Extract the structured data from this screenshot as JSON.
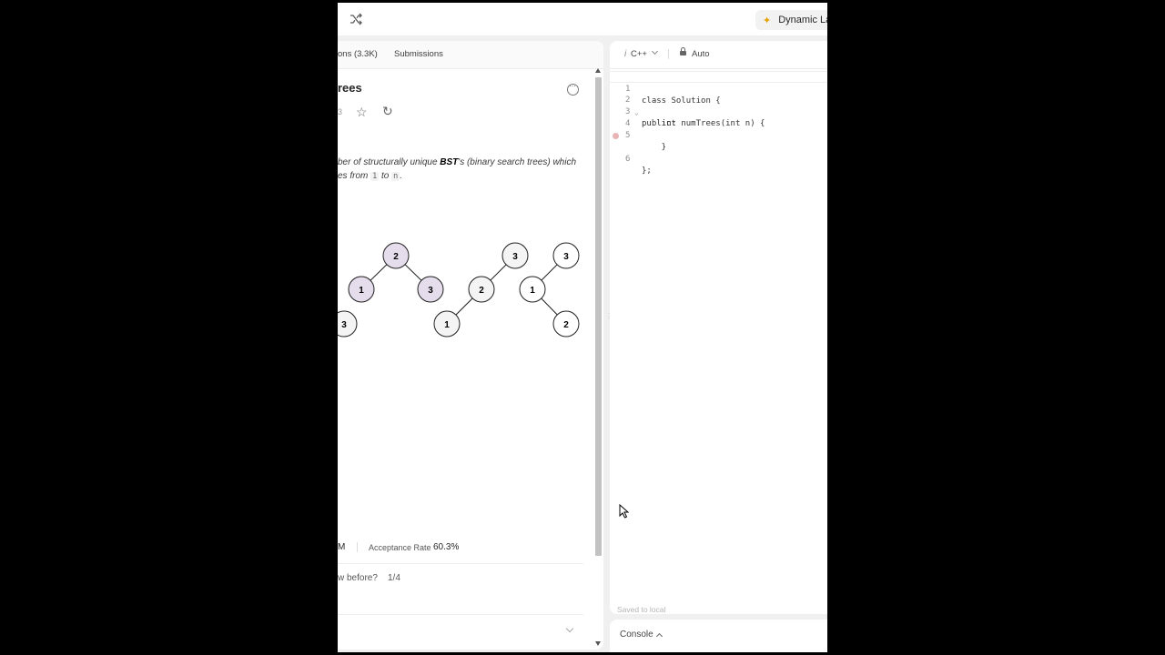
{
  "header": {
    "ai_button_label": "Dynamic Lay"
  },
  "left_panel": {
    "tabs": [
      "ons (3.3K)",
      "Submissions"
    ],
    "problem_title": "rees",
    "meta_fragment": "3",
    "description": {
      "part1": "ber of structurally unique ",
      "bst": "BST",
      "part2": "'s (binary search trees) which",
      "part3": "es from ",
      "code1": "1",
      "to": " to ",
      "code2": "n",
      "end": "."
    },
    "trees": {
      "tree1": [
        "3"
      ],
      "tree2": [
        "2",
        "1",
        "3"
      ],
      "tree3": [
        "3",
        "2",
        "1"
      ],
      "tree4": [
        "3",
        "1",
        "2"
      ]
    },
    "stats": {
      "submissions_fragment": "M",
      "acceptance_label": "Acceptance Rate",
      "acceptance_value": "60.3%"
    },
    "seen_before": {
      "question": "w before?",
      "value": "1/4"
    }
  },
  "editor": {
    "language": "C++",
    "mode": "Auto",
    "code_lines": [
      "class Solution {",
      "public:",
      "    int numTrees(int n) {",
      "",
      "    }",
      "};"
    ],
    "line_numbers": [
      "1",
      "2",
      "3",
      "4",
      "5",
      "6"
    ],
    "saved_status": "Saved to local"
  },
  "console": {
    "label": "Console"
  },
  "colors": {
    "highlight_node": "#e5dcec",
    "plain_node": "#f4f4f4",
    "accent_star": "#e6a100"
  },
  "icons": [
    "shuffle-icon",
    "sparkle-icon",
    "more-icon",
    "star-icon",
    "share-icon",
    "lock-icon",
    "code-icon",
    "chevron-down-icon",
    "chevron-up-icon"
  ]
}
